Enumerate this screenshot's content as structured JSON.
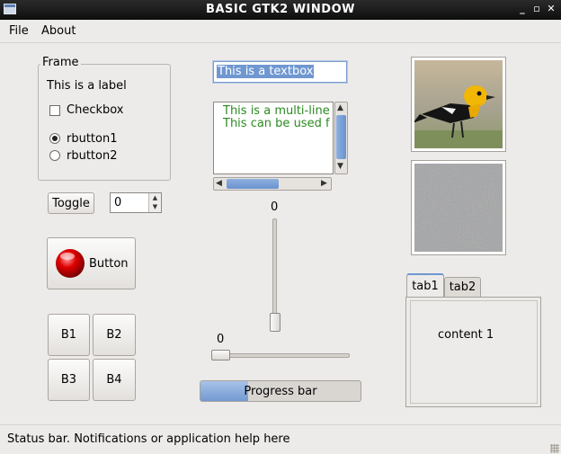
{
  "window": {
    "title": "BASIC GTK2 WINDOW",
    "minimize": "_",
    "maximize": "▫",
    "close": "✕"
  },
  "menu": {
    "file": "File",
    "about": "About"
  },
  "frame": {
    "legend": "Frame",
    "label": "This is a label",
    "checkbox": "Checkbox",
    "checkbox_checked": false,
    "radios": [
      {
        "label": "rbutton1",
        "selected": true
      },
      {
        "label": "rbutton2",
        "selected": false
      }
    ]
  },
  "toggle": {
    "label": "Toggle"
  },
  "spinner": {
    "value": "0"
  },
  "button": {
    "label": "Button"
  },
  "grid_buttons": [
    "B1",
    "B2",
    "B3",
    "B4"
  ],
  "textbox": {
    "value": "This is a textbox"
  },
  "multiline": {
    "lines": [
      "This is a multi-line",
      "This can be used f"
    ]
  },
  "vslider": {
    "value": "0",
    "level": 0
  },
  "hslider": {
    "value": "0",
    "level": 0
  },
  "progress": {
    "label": "Progress bar",
    "fraction": 0.3
  },
  "tabs": {
    "items": [
      "tab1",
      "tab2"
    ],
    "active": "tab1",
    "content": "content 1"
  },
  "status": {
    "text": "Status bar. Notifications or application help here"
  },
  "colors": {
    "title_bg": "#1a1a1a",
    "selection": "#6f97d0",
    "multiline_text": "#2a8a1f",
    "bird_body": "#1a1a1a",
    "bird_head": "#f2b705",
    "button_light": "#e00000"
  }
}
